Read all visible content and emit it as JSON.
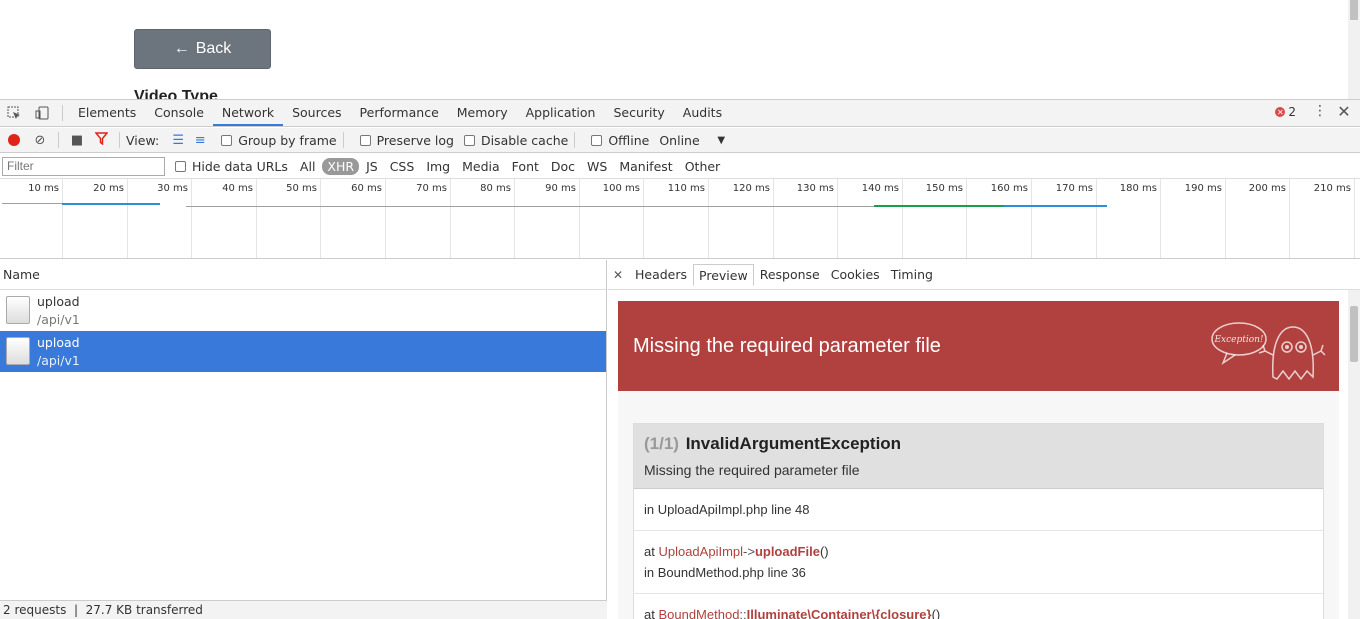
{
  "page": {
    "back_label": "Back",
    "heading": "Video Type"
  },
  "devtools": {
    "tabs": [
      "Elements",
      "Console",
      "Network",
      "Sources",
      "Performance",
      "Memory",
      "Application",
      "Security",
      "Audits"
    ],
    "active_tab": "Network",
    "error_count": "2",
    "toolbar": {
      "view_label": "View:",
      "group_by_frame": "Group by frame",
      "preserve_log": "Preserve log",
      "disable_cache": "Disable cache",
      "offline": "Offline",
      "throttle": "Online"
    },
    "filter": {
      "placeholder": "Filter",
      "hide_data_urls": "Hide data URLs",
      "types": [
        "All",
        "XHR",
        "JS",
        "CSS",
        "Img",
        "Media",
        "Font",
        "Doc",
        "WS",
        "Manifest",
        "Other"
      ],
      "active_type": "XHR"
    },
    "timeline": {
      "ticks": [
        "10 ms",
        "20 ms",
        "30 ms",
        "40 ms",
        "50 ms",
        "60 ms",
        "70 ms",
        "80 ms",
        "90 ms",
        "100 ms",
        "110 ms",
        "120 ms",
        "130 ms",
        "140 ms",
        "150 ms",
        "160 ms",
        "170 ms",
        "180 ms",
        "190 ms",
        "200 ms",
        "210 ms"
      ],
      "colors": {
        "waiting": "#1a9f4f",
        "receiving": "#2e8fd6",
        "queue": "#a0a0a0"
      }
    },
    "requests": {
      "name_header": "Name",
      "rows": [
        {
          "name": "upload",
          "path": "/api/v1"
        },
        {
          "name": "upload",
          "path": "/api/v1"
        }
      ],
      "status": "2 requests  |  27.7 KB transferred"
    },
    "detail_tabs": [
      "Headers",
      "Preview",
      "Response",
      "Cookies",
      "Timing"
    ],
    "active_detail_tab": "Preview",
    "preview": {
      "message": "Missing the required parameter file",
      "badge_text": "Exception!",
      "count": "(1/1)",
      "exception": "InvalidArgumentException",
      "sub": "Missing the required parameter file",
      "trace": {
        "t1_file": "in UploadApiImpl.php line 48",
        "t2_at": "at",
        "t2_class": "UploadApiImpl",
        "t2_op": "->",
        "t2_method": "uploadFile",
        "t2_args": "()",
        "t2_file": "in BoundMethod.php line 36",
        "t3_at": "at",
        "t3_class": "BoundMethod",
        "t3_op": "::",
        "t3_method": "Illuminate\\Container\\{closure}",
        "t3_args": "()"
      }
    },
    "colors": {
      "accent": "#3879d9",
      "exception_red": "#b0413e",
      "record": "#e2231a"
    }
  }
}
